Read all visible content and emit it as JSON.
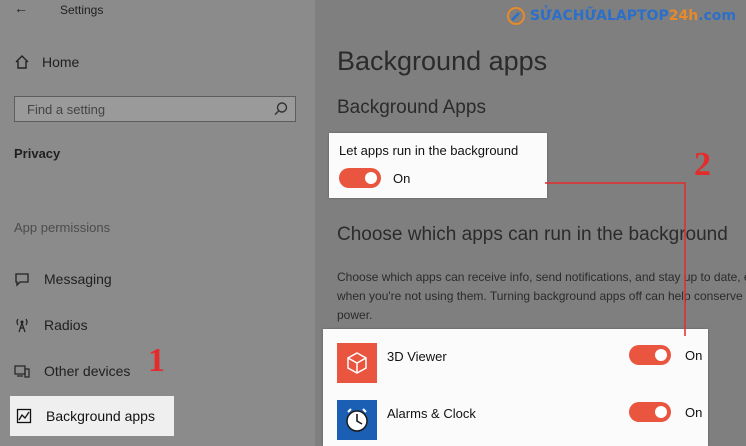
{
  "window": {
    "title": "Settings"
  },
  "sidebar": {
    "home_label": "Home",
    "search_placeholder": "Find a setting",
    "section_label": "Privacy",
    "group_label": "App permissions",
    "items": [
      {
        "label": "Messaging",
        "icon": "messaging-icon"
      },
      {
        "label": "Radios",
        "icon": "radio-tower-icon"
      },
      {
        "label": "Other devices",
        "icon": "devices-icon"
      },
      {
        "label": "Background apps",
        "icon": "background-apps-icon",
        "selected": true
      }
    ]
  },
  "main": {
    "page_title": "Background apps",
    "section_title": "Background Apps",
    "master_toggle": {
      "label": "Let apps run in the background",
      "state": "On",
      "on": true
    },
    "choose_title": "Choose which apps can run in the background",
    "description": "Choose which apps can receive info, send notifications, and stay up to date, even when you're not using them. Turning background apps off can help conserve power.",
    "apps": [
      {
        "name": "3D Viewer",
        "state": "On",
        "on": true,
        "icon": "3d-viewer-icon",
        "icon_bg": "#e9553f"
      },
      {
        "name": "Alarms & Clock",
        "state": "On",
        "on": true,
        "icon": "alarm-clock-icon",
        "icon_bg": "#1a5fb4"
      }
    ]
  },
  "annotations": {
    "step1": "1",
    "step2": "2",
    "color": "#e52b2b"
  },
  "watermark": {
    "text_main": "SỬACHỮALAPTOP",
    "text_accent": "24h",
    "text_suffix": ".com"
  },
  "colors": {
    "toggle_on": "#e9553f",
    "sidebar_bg": "#8b8b8b",
    "main_bg": "#7f7f7f",
    "selected_bg": "#efefef"
  }
}
